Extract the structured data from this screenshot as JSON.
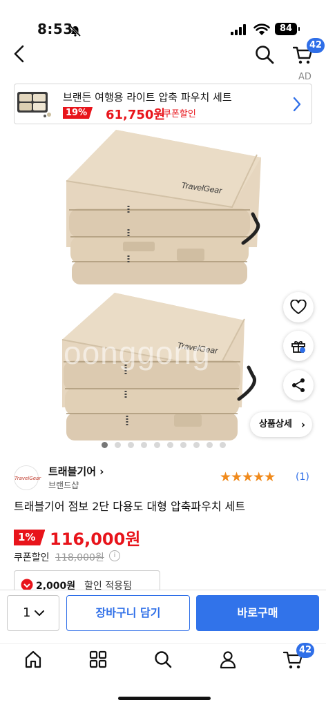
{
  "status_bar": {
    "time": "8:53",
    "battery": "84"
  },
  "header": {
    "cart_count": "42"
  },
  "ad": {
    "label": "AD",
    "title": "브랜든 여행용 라이트 압축 파우치 세트",
    "discount": "19%",
    "price": "61,750원",
    "coupon": "쿠폰할인"
  },
  "gallery": {
    "watermark": "oonggong",
    "total_images": 10,
    "active_index": 0,
    "detail_button": "상품상세"
  },
  "seller": {
    "logo_text": "TravelGear",
    "name": "트래블기어 ›",
    "type": "브랜드샵",
    "rating_stars": 5,
    "review_count": "(1)"
  },
  "product": {
    "title": "트래블기어 점보 2단 다용도 대형 압축파우치 세트",
    "discount": "1%",
    "price": "116,000원",
    "coupon_label": "쿠폰할인",
    "original_price": "118,000원",
    "coupon_amount": "2,000원",
    "coupon_applied": "할인 적용됨"
  },
  "purchase_bar": {
    "quantity": "1",
    "cart_button": "장바구니 담기",
    "buy_button": "바로구매"
  },
  "tab_bar": {
    "cart_count": "42"
  },
  "colors": {
    "accent": "#2f6fe8",
    "sale": "#e8141b",
    "star": "#f08a1c"
  }
}
